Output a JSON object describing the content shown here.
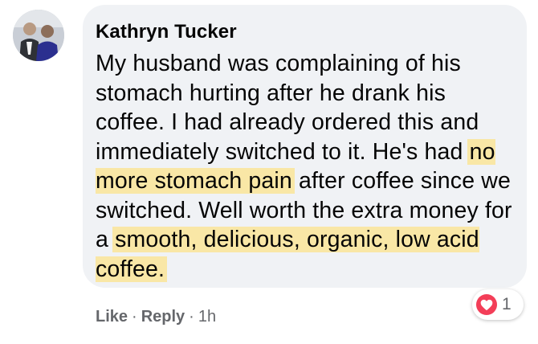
{
  "comment": {
    "author": "Kathryn Tucker",
    "text_before_h1": "My husband was complaining of his stomach hurting after he drank his coffee. I had already ordered this and immediately switched to it. He's had ",
    "highlight_1": "no more stomach pain",
    "text_between": " after coffee since we switched. Well worth the extra money for a ",
    "highlight_2": "smooth, delicious, organic, low acid coffee.",
    "highlight_color": "#f9e7a6"
  },
  "actions": {
    "like_label": "Like",
    "separator": "·",
    "reply_label": "Reply",
    "timestamp": "1h"
  },
  "reaction": {
    "icon": "heart-icon",
    "color": "#f33e58",
    "count": "1"
  },
  "colors": {
    "bubble": "#f0f2f5",
    "text": "#050505",
    "secondary_text": "#65676b"
  }
}
